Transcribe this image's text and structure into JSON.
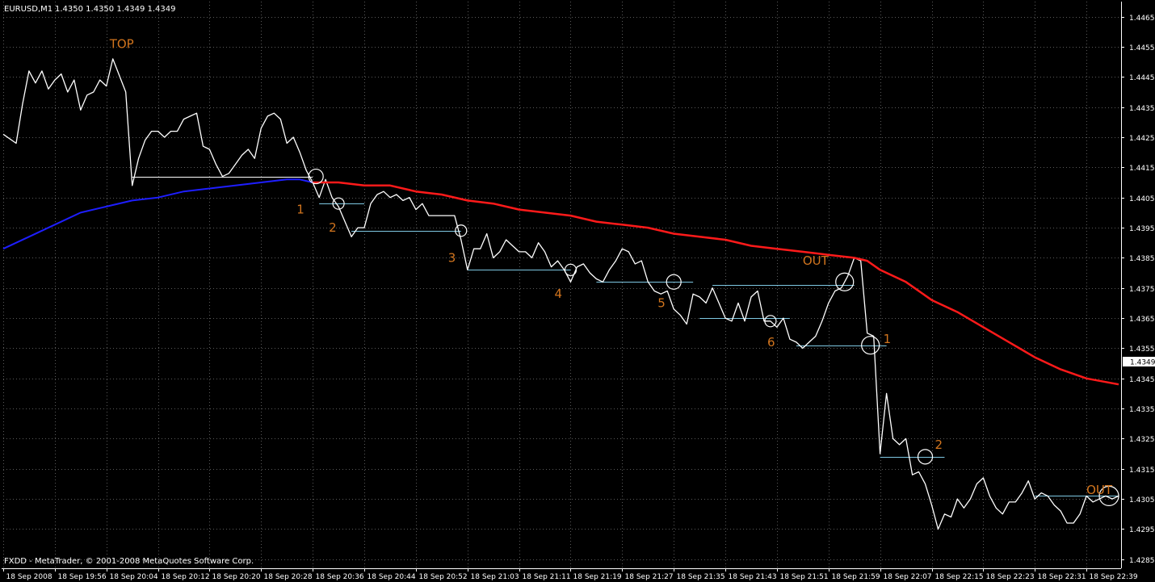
{
  "header": {
    "symbol": "EURUSD,M1",
    "ohlc": "1.4350 1.4350 1.4349 1.4349"
  },
  "footer": {
    "copyright": "FXDD - MetaTrader, © 2001-2008 MetaQuotes Software Corp."
  },
  "current_price": "1.4349",
  "colors": {
    "background": "#000000",
    "price": "#ffffff",
    "ma_blue": "#1e1eff",
    "ma_red": "#ff1a1a",
    "level": "#7ec8e3",
    "annotation": "#d2751e",
    "grid": "#5a5a5a",
    "axis": "#ffffff"
  },
  "chart_data": {
    "type": "line",
    "y_range": [
      1.4282,
      1.447
    ],
    "x_range": [
      0,
      173
    ],
    "y_ticks": [
      "1.4465",
      "1.4455",
      "1.4445",
      "1.4435",
      "1.4425",
      "1.4415",
      "1.4405",
      "1.4395",
      "1.4385",
      "1.4375",
      "1.4365",
      "1.4355",
      "1.4345",
      "1.4335",
      "1.4325",
      "1.4315",
      "1.4305",
      "1.4295",
      "1.4285"
    ],
    "x_ticks": [
      {
        "x": 0,
        "label": "18 Sep 2008"
      },
      {
        "x": 8,
        "label": "18 Sep 19:56"
      },
      {
        "x": 16,
        "label": "18 Sep 20:04"
      },
      {
        "x": 24,
        "label": "18 Sep 20:12"
      },
      {
        "x": 32,
        "label": "18 Sep 20:20"
      },
      {
        "x": 40,
        "label": "18 Sep 20:28"
      },
      {
        "x": 48,
        "label": "18 Sep 20:36"
      },
      {
        "x": 56,
        "label": "18 Sep 20:44"
      },
      {
        "x": 64,
        "label": "18 Sep 20:52"
      },
      {
        "x": 72,
        "label": "18 Sep 21:03"
      },
      {
        "x": 80,
        "label": "18 Sep 21:11"
      },
      {
        "x": 88,
        "label": "18 Sep 21:19"
      },
      {
        "x": 96,
        "label": "18 Sep 21:27"
      },
      {
        "x": 104,
        "label": "18 Sep 21:35"
      },
      {
        "x": 112,
        "label": "18 Sep 21:43"
      },
      {
        "x": 120,
        "label": "18 Sep 21:51"
      },
      {
        "x": 128,
        "label": "18 Sep 21:59"
      },
      {
        "x": 136,
        "label": "18 Sep 22:07"
      },
      {
        "x": 144,
        "label": "18 Sep 22:15"
      },
      {
        "x": 152,
        "label": "18 Sep 22:23"
      },
      {
        "x": 160,
        "label": "18 Sep 22:31"
      },
      {
        "x": 168,
        "label": "18 Sep 22:39"
      }
    ],
    "series": [
      {
        "color": "#ffffff",
        "points": [
          [
            0,
            1.4426
          ],
          [
            2,
            1.4423
          ],
          [
            3,
            1.4436
          ],
          [
            4,
            1.4447
          ],
          [
            5,
            1.4443
          ],
          [
            6,
            1.4447
          ],
          [
            7,
            1.4441
          ],
          [
            8,
            1.4444
          ],
          [
            9,
            1.4446
          ],
          [
            10,
            1.444
          ],
          [
            11,
            1.4444
          ],
          [
            12,
            1.4434
          ],
          [
            13,
            1.4439
          ],
          [
            14,
            1.444
          ],
          [
            15,
            1.4444
          ],
          [
            16,
            1.4442
          ],
          [
            17,
            1.4451
          ],
          [
            19,
            1.444
          ],
          [
            20,
            1.4409
          ],
          [
            21,
            1.4418
          ],
          [
            22,
            1.4424
          ],
          [
            23,
            1.4427
          ],
          [
            24,
            1.4427
          ],
          [
            25,
            1.4425
          ],
          [
            26,
            1.4427
          ],
          [
            27,
            1.4427
          ],
          [
            28,
            1.4431
          ],
          [
            29,
            1.4432
          ],
          [
            30,
            1.4433
          ],
          [
            31,
            1.4422
          ],
          [
            32,
            1.4421
          ],
          [
            33,
            1.4416
          ],
          [
            34,
            1.4412
          ],
          [
            35,
            1.4413
          ],
          [
            36,
            1.4416
          ],
          [
            37,
            1.4419
          ],
          [
            38,
            1.4421
          ],
          [
            39,
            1.4418
          ],
          [
            40,
            1.4428
          ],
          [
            41,
            1.4432
          ],
          [
            42,
            1.4433
          ],
          [
            43,
            1.4431
          ],
          [
            44,
            1.4423
          ],
          [
            45,
            1.4425
          ],
          [
            46,
            1.442
          ],
          [
            47,
            1.4414
          ],
          [
            48,
            1.441
          ],
          [
            49,
            1.4405
          ],
          [
            50,
            1.4411
          ],
          [
            51,
            1.4405
          ],
          [
            52,
            1.4402
          ],
          [
            53,
            1.4397
          ],
          [
            54,
            1.4392
          ],
          [
            55,
            1.4395
          ],
          [
            56,
            1.4395
          ],
          [
            57,
            1.4403
          ],
          [
            58,
            1.4406
          ],
          [
            59,
            1.4407
          ],
          [
            60,
            1.4405
          ],
          [
            61,
            1.4406
          ],
          [
            62,
            1.4404
          ],
          [
            63,
            1.4405
          ],
          [
            64,
            1.4401
          ],
          [
            65,
            1.4403
          ],
          [
            66,
            1.4399
          ],
          [
            67,
            1.4399
          ],
          [
            68,
            1.4399
          ],
          [
            69,
            1.4399
          ],
          [
            70,
            1.4399
          ],
          [
            71,
            1.4391
          ],
          [
            72,
            1.4381
          ],
          [
            73,
            1.4388
          ],
          [
            74,
            1.4388
          ],
          [
            75,
            1.4393
          ],
          [
            76,
            1.4385
          ],
          [
            77,
            1.4387
          ],
          [
            78,
            1.4391
          ],
          [
            79,
            1.4389
          ],
          [
            80,
            1.4387
          ],
          [
            81,
            1.4387
          ],
          [
            82,
            1.4385
          ],
          [
            83,
            1.439
          ],
          [
            84,
            1.4387
          ],
          [
            85,
            1.4382
          ],
          [
            86,
            1.4384
          ],
          [
            87,
            1.4381
          ],
          [
            88,
            1.4377
          ],
          [
            89,
            1.4382
          ],
          [
            90,
            1.4383
          ],
          [
            91,
            1.438
          ],
          [
            92,
            1.4378
          ],
          [
            93,
            1.4377
          ],
          [
            94,
            1.4381
          ],
          [
            95,
            1.4384
          ],
          [
            96,
            1.4388
          ],
          [
            97,
            1.4387
          ],
          [
            98,
            1.4383
          ],
          [
            99,
            1.4384
          ],
          [
            100,
            1.4377
          ],
          [
            101,
            1.4374
          ],
          [
            102,
            1.4373
          ],
          [
            103,
            1.4374
          ],
          [
            104,
            1.4368
          ],
          [
            105,
            1.4366
          ],
          [
            106,
            1.4363
          ],
          [
            107,
            1.4373
          ],
          [
            108,
            1.4372
          ],
          [
            109,
            1.437
          ],
          [
            110,
            1.4375
          ],
          [
            111,
            1.437
          ],
          [
            112,
            1.4365
          ],
          [
            113,
            1.4364
          ],
          [
            114,
            1.437
          ],
          [
            115,
            1.4364
          ],
          [
            116,
            1.4372
          ],
          [
            117,
            1.4374
          ],
          [
            118,
            1.4364
          ],
          [
            119,
            1.4364
          ],
          [
            120,
            1.4362
          ],
          [
            121,
            1.4365
          ],
          [
            122,
            1.4358
          ],
          [
            123,
            1.4357
          ],
          [
            124,
            1.4355
          ],
          [
            125,
            1.4357
          ],
          [
            126,
            1.4359
          ],
          [
            127,
            1.4364
          ],
          [
            128,
            1.437
          ],
          [
            129,
            1.4374
          ],
          [
            130,
            1.4375
          ],
          [
            131,
            1.4379
          ],
          [
            132,
            1.4385
          ],
          [
            133,
            1.4384
          ],
          [
            134,
            1.436
          ],
          [
            135,
            1.4359
          ],
          [
            136,
            1.432
          ],
          [
            137,
            1.434
          ],
          [
            138,
            1.4325
          ],
          [
            139,
            1.4323
          ],
          [
            140,
            1.4325
          ],
          [
            141,
            1.4313
          ],
          [
            142,
            1.4314
          ],
          [
            143,
            1.431
          ],
          [
            144,
            1.4303
          ],
          [
            145,
            1.4295
          ],
          [
            146,
            1.43
          ],
          [
            147,
            1.4299
          ],
          [
            148,
            1.4305
          ],
          [
            149,
            1.4302
          ],
          [
            150,
            1.4305
          ],
          [
            151,
            1.431
          ],
          [
            152,
            1.4312
          ],
          [
            153,
            1.4306
          ],
          [
            154,
            1.4302
          ],
          [
            155,
            1.43
          ],
          [
            156,
            1.4304
          ],
          [
            157,
            1.4304
          ],
          [
            158,
            1.4307
          ],
          [
            159,
            1.4311
          ],
          [
            160,
            1.4305
          ],
          [
            161,
            1.4307
          ],
          [
            162,
            1.4306
          ],
          [
            163,
            1.4303
          ],
          [
            164,
            1.4301
          ],
          [
            165,
            1.4297
          ],
          [
            166,
            1.4297
          ],
          [
            167,
            1.43
          ],
          [
            168,
            1.4306
          ],
          [
            169,
            1.4304
          ],
          [
            170,
            1.4305
          ],
          [
            171,
            1.4306
          ],
          [
            172,
            1.4305
          ],
          [
            173,
            1.4306
          ]
        ]
      },
      {
        "color": "#1e1eff",
        "points": [
          [
            0,
            1.4388
          ],
          [
            4,
            1.4392
          ],
          [
            8,
            1.4396
          ],
          [
            12,
            1.44
          ],
          [
            16,
            1.4402
          ],
          [
            20,
            1.4404
          ],
          [
            24,
            1.4405
          ],
          [
            28,
            1.4407
          ],
          [
            32,
            1.4408
          ],
          [
            36,
            1.4409
          ],
          [
            40,
            1.441
          ],
          [
            44,
            1.4411
          ],
          [
            46,
            1.4411
          ],
          [
            48,
            1.441
          ]
        ]
      },
      {
        "color": "#ff1a1a",
        "points": [
          [
            48,
            1.441
          ],
          [
            52,
            1.441
          ],
          [
            56,
            1.4409
          ],
          [
            60,
            1.4409
          ],
          [
            64,
            1.4407
          ],
          [
            68,
            1.4406
          ],
          [
            72,
            1.4404
          ],
          [
            76,
            1.4403
          ],
          [
            80,
            1.4401
          ],
          [
            84,
            1.44
          ],
          [
            88,
            1.4399
          ],
          [
            92,
            1.4397
          ],
          [
            96,
            1.4396
          ],
          [
            100,
            1.4395
          ],
          [
            104,
            1.4393
          ],
          [
            108,
            1.4392
          ],
          [
            112,
            1.4391
          ],
          [
            116,
            1.4389
          ],
          [
            120,
            1.4388
          ],
          [
            124,
            1.4387
          ],
          [
            128,
            1.4386
          ],
          [
            132,
            1.4385
          ],
          [
            134,
            1.4384
          ],
          [
            136,
            1.4381
          ],
          [
            140,
            1.4377
          ],
          [
            144,
            1.4371
          ],
          [
            148,
            1.4367
          ],
          [
            152,
            1.4362
          ],
          [
            156,
            1.4357
          ],
          [
            160,
            1.4352
          ],
          [
            164,
            1.4348
          ],
          [
            168,
            1.4345
          ],
          [
            173,
            1.4343
          ]
        ]
      }
    ],
    "levels": [
      {
        "x1": 20,
        "x2": 48,
        "y": 1.4412,
        "color": "#ffffff"
      },
      {
        "x1": 49,
        "x2": 56,
        "y": 1.4403,
        "color": "#7ec8e3"
      },
      {
        "x1": 54,
        "x2": 71,
        "y": 1.4394,
        "color": "#7ec8e3"
      },
      {
        "x1": 72,
        "x2": 88,
        "y": 1.4381,
        "color": "#7ec8e3"
      },
      {
        "x1": 92,
        "x2": 107,
        "y": 1.4377,
        "color": "#7ec8e3"
      },
      {
        "x1": 110,
        "x2": 132,
        "y": 1.4376,
        "color": "#7ec8e3"
      },
      {
        "x1": 108,
        "x2": 122,
        "y": 1.4365,
        "color": "#7ec8e3"
      },
      {
        "x1": 123,
        "x2": 137,
        "y": 1.4356,
        "color": "#7ec8e3"
      },
      {
        "x1": 136,
        "x2": 146,
        "y": 1.4319,
        "color": "#7ec8e3"
      },
      {
        "x1": 160,
        "x2": 173,
        "y": 1.4306,
        "color": "#7ec8e3"
      }
    ],
    "markers": [
      {
        "x": 48.5,
        "y": 1.4412,
        "r": 9,
        "label": "1",
        "lx": 45.5,
        "ly": 1.4401
      },
      {
        "x": 52,
        "y": 1.4403,
        "r": 7,
        "label": "2",
        "lx": 50.5,
        "ly": 1.4395
      },
      {
        "x": 71,
        "y": 1.4394,
        "r": 7,
        "label": "3",
        "lx": 69,
        "ly": 1.4385
      },
      {
        "x": 88,
        "y": 1.4381,
        "r": 7,
        "label": "4",
        "lx": 85.5,
        "ly": 1.4373
      },
      {
        "x": 104,
        "y": 1.4377,
        "r": 9,
        "label": "5",
        "lx": 101.5,
        "ly": 1.437
      },
      {
        "x": 119,
        "y": 1.4364,
        "r": 7,
        "label": "6",
        "lx": 118.5,
        "ly": 1.4357
      },
      {
        "x": 130.5,
        "y": 1.4377,
        "r": 11,
        "label": "OUT",
        "lx": 124,
        "ly": 1.4384
      },
      {
        "x": 134.5,
        "y": 1.4356,
        "r": 11,
        "label": "1",
        "lx": 136.5,
        "ly": 1.4358
      },
      {
        "x": 143,
        "y": 1.4319,
        "r": 9,
        "label": "2",
        "lx": 144.5,
        "ly": 1.4323
      },
      {
        "x": 171.5,
        "y": 1.4306,
        "r": 12,
        "label": "OUT",
        "lx": 168,
        "ly": 1.4308
      }
    ],
    "texts": [
      {
        "x": 16.5,
        "y": 1.4456,
        "label": "TOP"
      }
    ]
  }
}
